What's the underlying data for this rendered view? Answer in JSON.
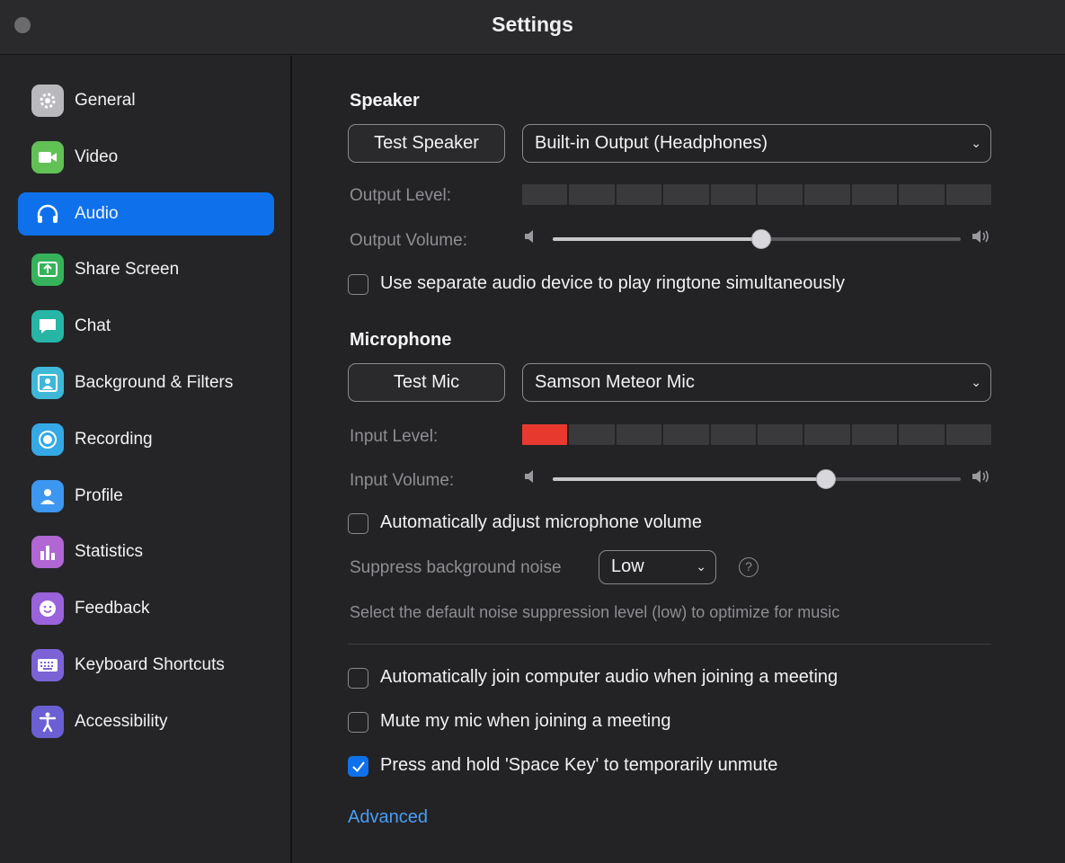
{
  "window": {
    "title": "Settings"
  },
  "sidebar": {
    "items": [
      {
        "label": "General",
        "icon": "gear-icon",
        "color": "#b9b9bd"
      },
      {
        "label": "Video",
        "icon": "video-camera-icon",
        "color": "#62c155"
      },
      {
        "label": "Audio",
        "icon": "headphones-icon",
        "color": "#0e71eb",
        "active": true
      },
      {
        "label": "Share Screen",
        "icon": "share-screen-icon",
        "color": "#36b35a"
      },
      {
        "label": "Chat",
        "icon": "chat-bubble-icon",
        "color": "#27b5a6"
      },
      {
        "label": "Background & Filters",
        "icon": "background-icon",
        "color": "#3fb8d8"
      },
      {
        "label": "Recording",
        "icon": "record-icon",
        "color": "#34a9e6"
      },
      {
        "label": "Profile",
        "icon": "person-icon",
        "color": "#3d96ef"
      },
      {
        "label": "Statistics",
        "icon": "bar-chart-icon",
        "color": "#b066d3"
      },
      {
        "label": "Feedback",
        "icon": "smiley-icon",
        "color": "#9a63db"
      },
      {
        "label": "Keyboard Shortcuts",
        "icon": "keyboard-icon",
        "color": "#7b63d6"
      },
      {
        "label": "Accessibility",
        "icon": "accessibility-icon",
        "color": "#6a5fd3"
      }
    ]
  },
  "speaker": {
    "title": "Speaker",
    "test_button": "Test Speaker",
    "device": "Built-in Output (Headphones)",
    "output_level_label": "Output Level:",
    "output_level_active_segments": 0,
    "output_volume_label": "Output Volume:",
    "output_volume": 0.51,
    "ringtone_checkbox": {
      "label": "Use separate audio device to play ringtone simultaneously",
      "checked": false
    }
  },
  "microphone": {
    "title": "Microphone",
    "test_button": "Test Mic",
    "device": "Samson Meteor Mic",
    "input_level_label": "Input Level:",
    "input_level_active_segments": 1,
    "input_volume_label": "Input Volume:",
    "input_volume": 0.67,
    "auto_adjust_checkbox": {
      "label": "Automatically adjust microphone volume",
      "checked": false
    },
    "suppress_label": "Suppress background noise",
    "suppress_value": "Low",
    "suppress_hint": "Select the default noise suppression level (low) to optimize for music"
  },
  "options": {
    "auto_join": {
      "label": "Automatically join computer audio when joining a meeting",
      "checked": false
    },
    "mute_on_join": {
      "label": "Mute my mic when joining a meeting",
      "checked": false
    },
    "space_unmute": {
      "label": "Press and hold 'Space Key' to temporarily unmute",
      "checked": true
    },
    "advanced_link": "Advanced"
  },
  "colors": {
    "accent": "#0e71eb",
    "input_level_on": "#e8392f",
    "link": "#4a9df6"
  }
}
